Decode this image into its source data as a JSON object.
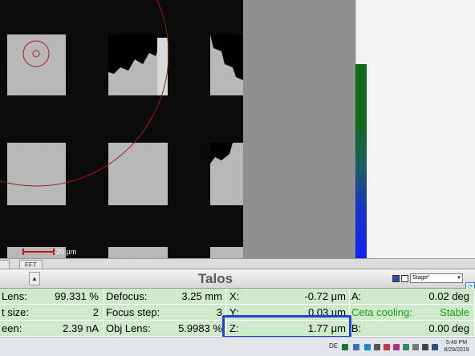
{
  "viewer": {
    "scale_label": "20 μm",
    "side_panel_color": "#8f8f8f",
    "histogram_colors": [
      "#0f6b18",
      "#1533c9"
    ]
  },
  "tabs": [
    "",
    "FFT"
  ],
  "header": {
    "title": "Talos",
    "stage_selector_value": "Stage²"
  },
  "readouts": [
    {
      "label": "Lens:",
      "value": "99.331 %"
    },
    {
      "label": "t size:",
      "value": "2"
    },
    {
      "label": "een:",
      "value": "2.39 nA"
    },
    {
      "label": "Defocus:",
      "value": "3.25 mm"
    },
    {
      "label": "Focus step:",
      "value": "3"
    },
    {
      "label": "Obj Lens:",
      "value": "5.9983 %"
    },
    {
      "label": "X:",
      "value": "-0.72 μm"
    },
    {
      "label": "Y:",
      "value": "0.03 um"
    },
    {
      "label": "Z:",
      "value": "1.77 μm"
    },
    {
      "label": "A:",
      "value": "0.02 deg"
    },
    {
      "label": "Ceta cooling:",
      "value": "Stable"
    },
    {
      "label": "B:",
      "value": "0.00 deg"
    }
  ],
  "taskbar": {
    "language": "DE",
    "time": "5:49 PM",
    "date": "8/29/2019"
  },
  "colors": {
    "readout_bg": "#cfe9cb",
    "highlight_border": "#1f43d8",
    "status_green": "#1a9a1a"
  }
}
